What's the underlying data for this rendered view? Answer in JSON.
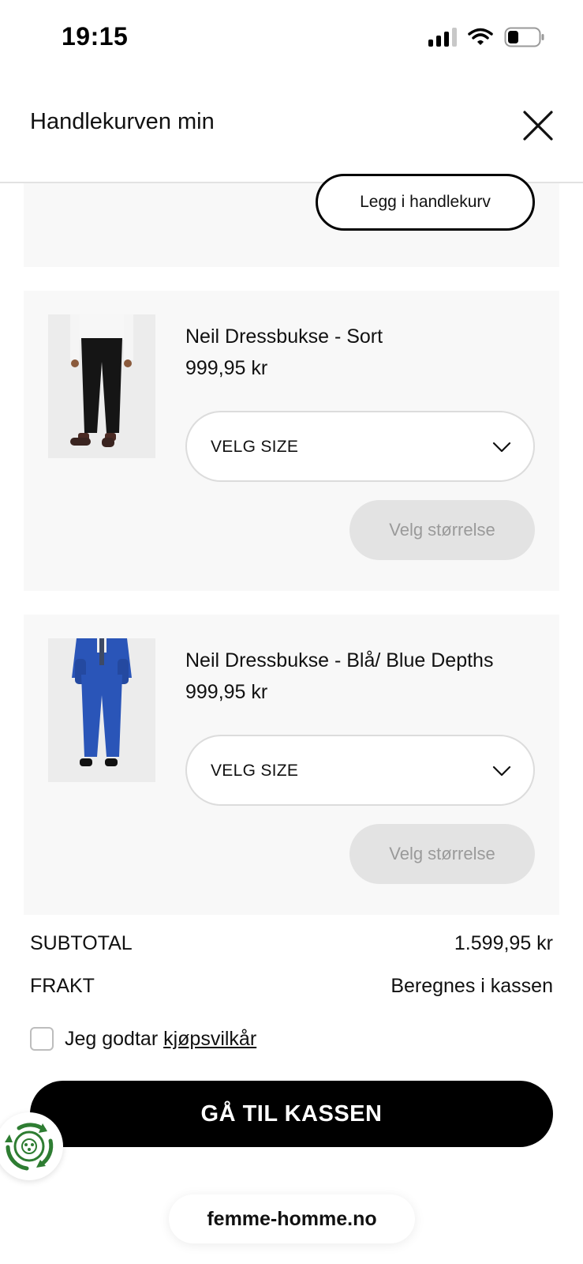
{
  "status_bar": {
    "time": "19:15"
  },
  "header": {
    "title": "Handlekurven min"
  },
  "top_card": {
    "add_to_cart_label": "Legg i handlekurv"
  },
  "products": [
    {
      "name": "Neil Dressbukse - Sort",
      "price": "999,95 kr",
      "size_placeholder": "VELG SIZE",
      "choose_size_label": "Velg størrelse",
      "trouser_color": "#151515",
      "jacket_color": "#f4f4f4"
    },
    {
      "name": "Neil Dressbukse - Blå/ Blue Depths",
      "price": "999,95 kr",
      "size_placeholder": "VELG SIZE",
      "choose_size_label": "Velg størrelse",
      "trouser_color": "#2a55b8",
      "jacket_color": "#2a55b8"
    }
  ],
  "summary": {
    "subtotal_label": "SUBTOTAL",
    "subtotal_value": "1.599,95 kr",
    "shipping_label": "FRAKT",
    "shipping_value": "Beregnes i kassen"
  },
  "terms": {
    "text": "Jeg godtar",
    "link": "kjøpsvilkår",
    "checked": false
  },
  "checkout": {
    "label": "GÅ TIL KASSEN"
  },
  "browser": {
    "url": "femme-homme.no"
  },
  "colors": {
    "accent": "#000000",
    "card_bg": "#f8f8f8",
    "disabled_bg": "#e3e3e3",
    "eco_green": "#2e7d32"
  }
}
